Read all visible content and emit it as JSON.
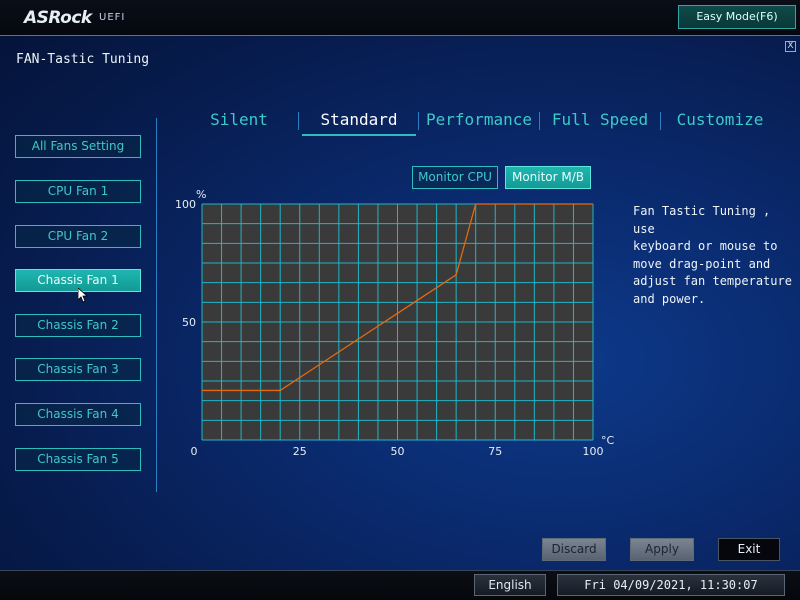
{
  "header": {
    "logo_text": "ASRock",
    "logo_sub": "UEFI",
    "easy_mode_label": "Easy Mode(F6)",
    "close_label": "X"
  },
  "page_title": "FAN-Tastic Tuning",
  "sidebar": {
    "items": [
      {
        "label": "All Fans Setting",
        "active": false
      },
      {
        "label": "CPU Fan 1",
        "active": false
      },
      {
        "label": "CPU Fan 2",
        "active": false
      },
      {
        "label": "Chassis Fan 1",
        "active": true
      },
      {
        "label": "Chassis Fan 2",
        "active": false
      },
      {
        "label": "Chassis Fan 3",
        "active": false
      },
      {
        "label": "Chassis Fan 4",
        "active": false
      },
      {
        "label": "Chassis Fan 5",
        "active": false
      }
    ]
  },
  "tabs": [
    {
      "label": "Silent",
      "active": false
    },
    {
      "label": "Standard",
      "active": true
    },
    {
      "label": "Performance",
      "active": false
    },
    {
      "label": "Full Speed",
      "active": false
    },
    {
      "label": "Customize",
      "active": false
    }
  ],
  "monitor": {
    "cpu_label": "Monitor CPU",
    "mb_label": "Monitor M/B",
    "selected": "Monitor M/B"
  },
  "chart_data": {
    "type": "line",
    "x_unit": "°C",
    "y_unit": "%",
    "xlim": [
      0,
      100
    ],
    "ylim": [
      0,
      100
    ],
    "x_ticks": [
      "0",
      "25",
      "50",
      "75",
      "100"
    ],
    "y_ticks": [
      "100",
      "50"
    ],
    "grid": true,
    "series": [
      {
        "x": [
          0,
          20,
          65,
          70,
          100
        ],
        "y": [
          21,
          21,
          70,
          100,
          100
        ]
      }
    ],
    "colors": {
      "line": "#e06a10",
      "grid": "#1fb6c8",
      "plot_bg": "#3a3a3a"
    }
  },
  "help_text": "Fan Tastic Tuning , use\nkeyboard or mouse to\nmove drag-point and\nadjust fan temperature\nand power.",
  "actions": {
    "discard_label": "Discard",
    "apply_label": "Apply",
    "exit_label": "Exit"
  },
  "statusbar": {
    "language": "English",
    "datetime": "Fri 04/09/2021, 11:30:07"
  }
}
